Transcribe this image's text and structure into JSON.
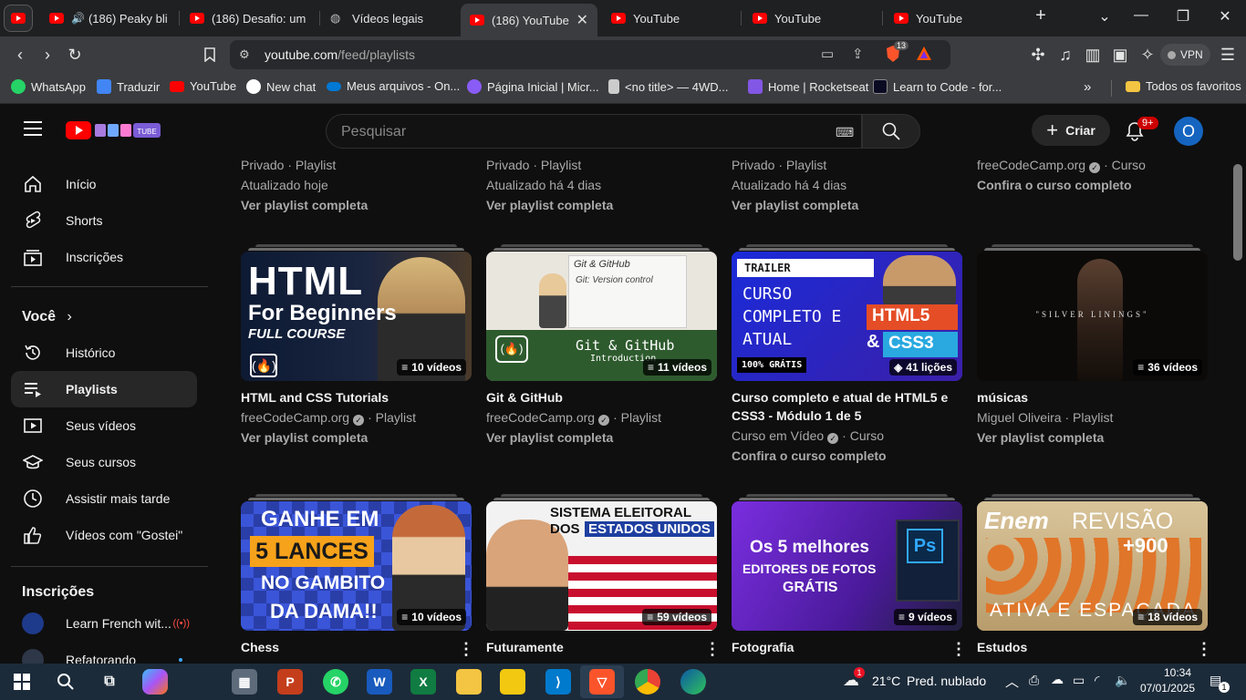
{
  "browser": {
    "tabs": [
      {
        "label": "(186) Peaky blin",
        "muted": true
      },
      {
        "label": "(186) Desafio: um si"
      },
      {
        "label": "Vídeos legais"
      },
      {
        "label": "(186) YouTube",
        "active": true
      },
      {
        "label": "YouTube"
      },
      {
        "label": "YouTube"
      },
      {
        "label": "YouTube"
      }
    ],
    "url_host": "youtube.com",
    "url_path": "/feed/playlists",
    "brave_count": "13",
    "vpn_label": "VPN",
    "bookmarks": [
      {
        "label": "WhatsApp",
        "color": "#25d366"
      },
      {
        "label": "Traduzir",
        "color": "#4285f4"
      },
      {
        "label": "YouTube",
        "color": "#ff0000"
      },
      {
        "label": "New chat",
        "color": "#ffffff"
      },
      {
        "label": "Meus arquivos - On...",
        "color": "#0078d4"
      },
      {
        "label": "Página Inicial | Micr...",
        "color": "#8a5cf6"
      },
      {
        "label": "<no title> — 4WD...",
        "color": "#cccccc"
      },
      {
        "label": "Home | Rocketseat",
        "color": "#8257e5"
      },
      {
        "label": "Learn to Code - for...",
        "color": "#0a0a23"
      }
    ],
    "all_favorites": "Todos os favoritos"
  },
  "header": {
    "search_placeholder": "Pesquisar",
    "create_label": "Criar",
    "notif_count": "9+",
    "avatar_letter": "O"
  },
  "sidebar": {
    "main": [
      {
        "label": "Início",
        "icon": "home-icon"
      },
      {
        "label": "Shorts",
        "icon": "shorts-icon"
      },
      {
        "label": "Inscrições",
        "icon": "subscriptions-icon"
      }
    ],
    "you_title": "Você",
    "you_items": [
      {
        "label": "Histórico",
        "icon": "history-icon"
      },
      {
        "label": "Playlists",
        "icon": "playlists-icon",
        "active": true
      },
      {
        "label": "Seus vídeos",
        "icon": "your-videos-icon"
      },
      {
        "label": "Seus cursos",
        "icon": "courses-icon"
      },
      {
        "label": "Assistir mais tarde",
        "icon": "watch-later-icon"
      },
      {
        "label": "Vídeos com \"Gostei\"",
        "icon": "liked-icon"
      }
    ],
    "subs_title": "Inscrições",
    "subs": [
      {
        "label": "Learn French wit..."
      },
      {
        "label": "Refatorando"
      }
    ]
  },
  "top_row": [
    {
      "line1": "Privado · Playlist",
      "line2": "Atualizado hoje",
      "link": "Ver playlist completa"
    },
    {
      "line1": "Privado · Playlist",
      "line2": "Atualizado há 4 dias",
      "link": "Ver playlist completa"
    },
    {
      "line1": "Privado · Playlist",
      "line2": "Atualizado há 4 dias",
      "link": "Ver playlist completa"
    },
    {
      "line1_channel": "freeCodeCamp.org",
      "line1_suffix": "· Curso",
      "link": "Confira o curso completo"
    }
  ],
  "row2": [
    {
      "title": "HTML and CSS Tutorials",
      "channel": "freeCodeCamp.org",
      "kind": "· Playlist",
      "link": "Ver playlist completa",
      "count": "10 vídeos",
      "thumb": {
        "big": "HTML",
        "sub": "For Beginners",
        "sub2": "FULL COURSE"
      }
    },
    {
      "title": "Git & GitHub",
      "channel": "freeCodeCamp.org",
      "kind": "· Playlist",
      "link": "Ver playlist completa",
      "count": "11 vídeos",
      "thumb": {
        "big": "Git & GitHub",
        "sub": "Introduction",
        "board1": "Git & GitHub",
        "board2": "Git: Version control"
      }
    },
    {
      "title": "Curso completo e atual de HTML5 e CSS3 - Módulo 1 de 5",
      "channel": "Curso em Vídeo",
      "kind": "· Curso",
      "link": "Confira o curso completo",
      "count": "41 lições",
      "thumb": {
        "tag": "TRAILER",
        "big": "CURSO COMPLETO E ATUAL",
        "html": "HTML5",
        "css": "CSS3",
        "free": "100% GRÁTIS"
      }
    },
    {
      "title": "músicas",
      "channel": "Miguel Oliveira",
      "kind": "· Playlist",
      "link": "Ver playlist completa",
      "count": "36 vídeos",
      "thumb": {
        "big": "\"SILVER LININGS\""
      }
    }
  ],
  "row3": [
    {
      "title": "Chess",
      "count": "10 vídeos",
      "thumb": {
        "l1": "GANHE EM",
        "l2": "5 LANCES",
        "l3": "NO GAMBITO",
        "l4": "DA DAMA!!"
      }
    },
    {
      "title": "Futuramente",
      "count": "59 vídeos",
      "thumb": {
        "l1": "SISTEMA ELEITORAL",
        "l2": "DOS",
        "l3": "ESTADOS UNIDOS"
      }
    },
    {
      "title": "Fotografia",
      "count": "9 vídeos",
      "thumb": {
        "l1": "Os 5 melhores",
        "l2": "EDITORES DE FOTOS",
        "l3": "GRÁTIS",
        "ps": "Ps"
      }
    },
    {
      "title": "Estudos",
      "count": "18 vídeos",
      "thumb": {
        "l1": "Enem",
        "l2": "REVISÃO",
        "l3": "+900",
        "l4": "ATIVA E ESPAÇADA"
      }
    }
  ],
  "taskbar": {
    "weather_temp": "21°C",
    "weather_desc": "Pred. nublado",
    "time": "10:34",
    "date": "07/01/2025",
    "notif_count": "1"
  }
}
